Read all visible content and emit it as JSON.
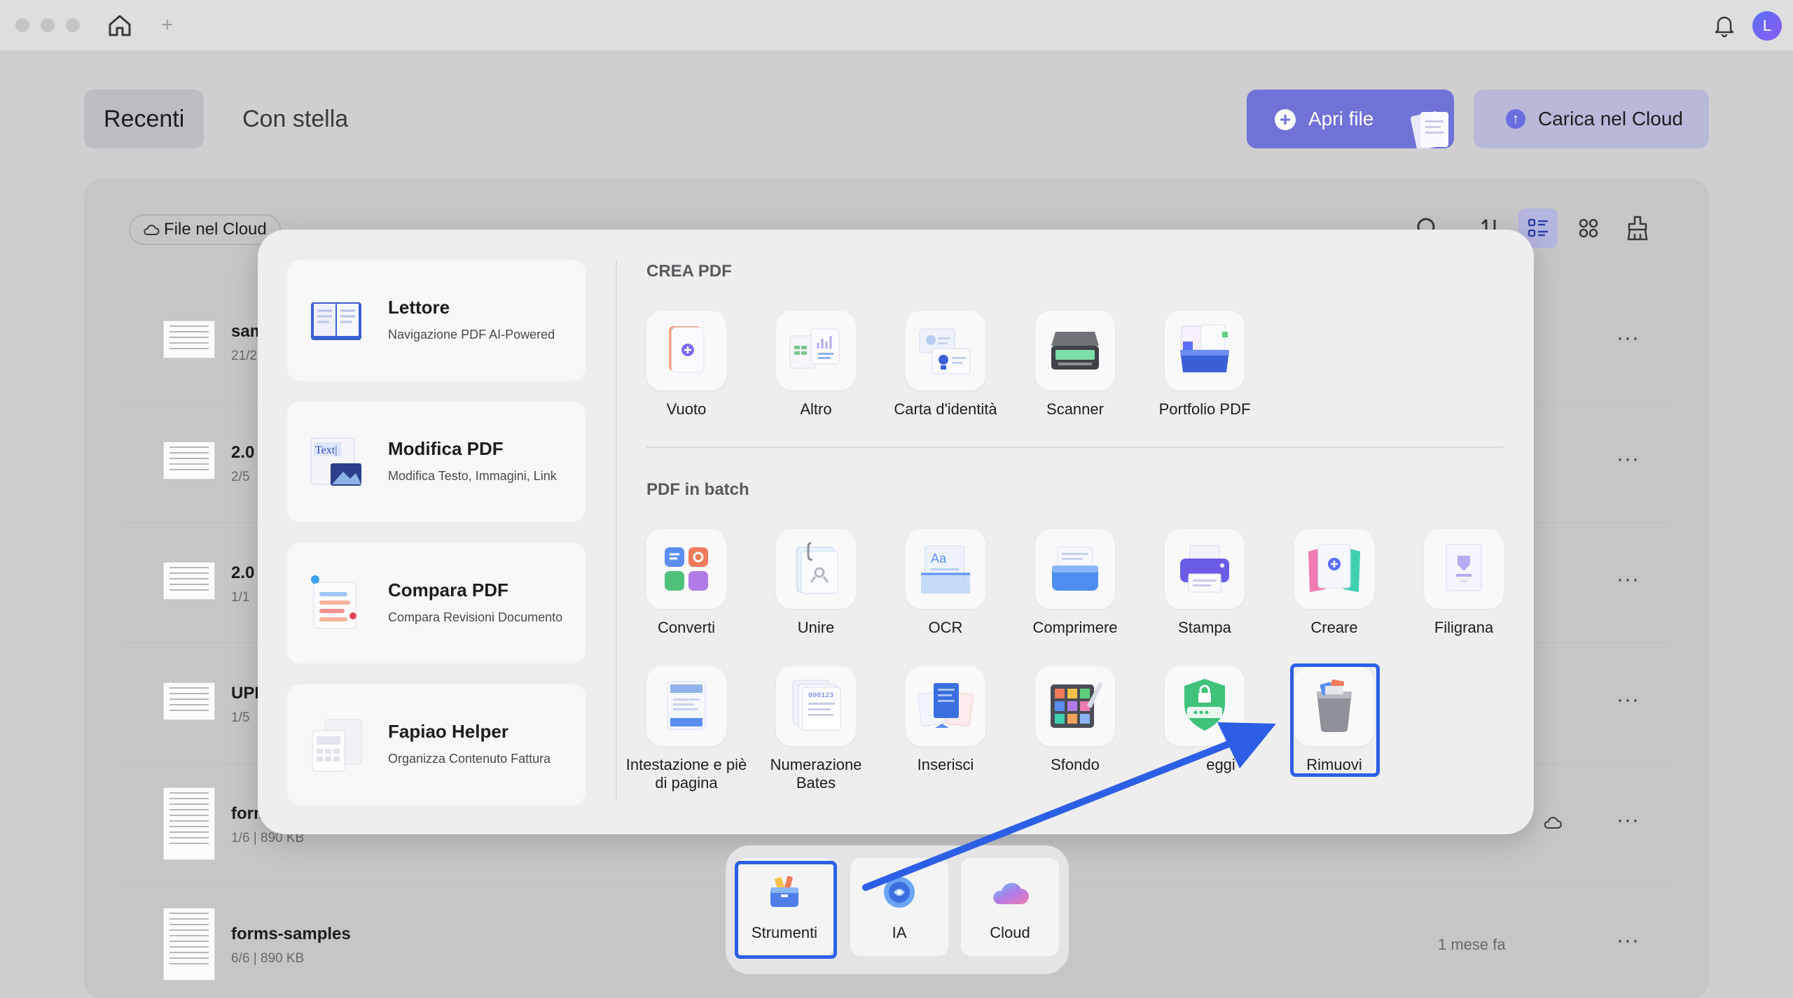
{
  "titlebar": {
    "new_tab_symbol": "+",
    "avatar_letter": "L"
  },
  "tabs": [
    {
      "label": "Recenti",
      "active": true
    },
    {
      "label": "Con stella",
      "active": false
    }
  ],
  "actions": {
    "open_file": "Apri file",
    "upload_cloud": "Carica nel Cloud"
  },
  "files": {
    "cloud_filter": "File nel Cloud",
    "rows": [
      {
        "name": "sam",
        "meta": "21/2",
        "date": "",
        "thumb": "landscape"
      },
      {
        "name": "2.0",
        "meta": "2/5",
        "date": "",
        "thumb": "landscape"
      },
      {
        "name": "2.0",
        "meta": "1/1",
        "date": "",
        "thumb": "landscape"
      },
      {
        "name": "UPD",
        "meta": "1/5",
        "date": "",
        "thumb": "landscape"
      },
      {
        "name": "form",
        "meta": "1/6  |  890 KB",
        "date": "",
        "thumb": "portrait"
      },
      {
        "name": "forms-samples",
        "meta": "6/6  |  890 KB",
        "date": "1 mese fa",
        "thumb": "portrait"
      }
    ],
    "more_symbol": "···"
  },
  "popover": {
    "features": [
      {
        "title": "Lettore",
        "subtitle": "Navigazione PDF AI-Powered",
        "icon": "book-icon"
      },
      {
        "title": "Modifica PDF",
        "subtitle": "Modifica Testo, Immagini, Link",
        "icon": "edit-text-icon"
      },
      {
        "title": "Compara PDF",
        "subtitle": "Compara Revisioni Documento",
        "icon": "compare-icon"
      },
      {
        "title": "Fapiao Helper",
        "subtitle": "Organizza Contenuto Fattura",
        "icon": "invoice-icon"
      }
    ],
    "create_section": {
      "title": "CREA PDF",
      "items": [
        {
          "label": "Vuoto",
          "icon": "blank-pdf-icon"
        },
        {
          "label": "Altro",
          "icon": "other-icon"
        },
        {
          "label": "Carta d'identità",
          "icon": "id-card-icon"
        },
        {
          "label": "Scanner",
          "icon": "scanner-icon"
        },
        {
          "label": "Portfolio PDF",
          "icon": "portfolio-icon"
        }
      ]
    },
    "batch_section": {
      "title": "PDF in batch",
      "items": [
        {
          "label": "Converti",
          "icon": "convert-icon"
        },
        {
          "label": "Unire",
          "icon": "merge-icon"
        },
        {
          "label": "OCR",
          "icon": "ocr-icon"
        },
        {
          "label": "Comprimere",
          "icon": "compress-icon"
        },
        {
          "label": "Stampa",
          "icon": "print-icon"
        },
        {
          "label": "Creare",
          "icon": "create-icon"
        },
        {
          "label": "Filigrana",
          "icon": "watermark-icon"
        },
        {
          "label": "Intestazione e piè di pagina",
          "icon": "header-footer-icon"
        },
        {
          "label": "Numerazione Bates",
          "icon": "bates-icon"
        },
        {
          "label": "Inserisci",
          "icon": "insert-icon"
        },
        {
          "label": "Sfondo",
          "icon": "background-icon"
        },
        {
          "label": "eggi",
          "icon": "protect-icon"
        },
        {
          "label": "Rimuovi",
          "icon": "trash-icon"
        }
      ]
    }
  },
  "dock": [
    {
      "label": "Strumenti",
      "icon": "toolbox-icon",
      "active": true
    },
    {
      "label": "IA",
      "icon": "ai-icon",
      "active": false
    },
    {
      "label": "Cloud",
      "icon": "cloud-icon",
      "active": false
    }
  ],
  "colors": {
    "accent": "#7172d8",
    "highlight": "#2d5fe6",
    "upload_button": "#b8b9d9"
  }
}
